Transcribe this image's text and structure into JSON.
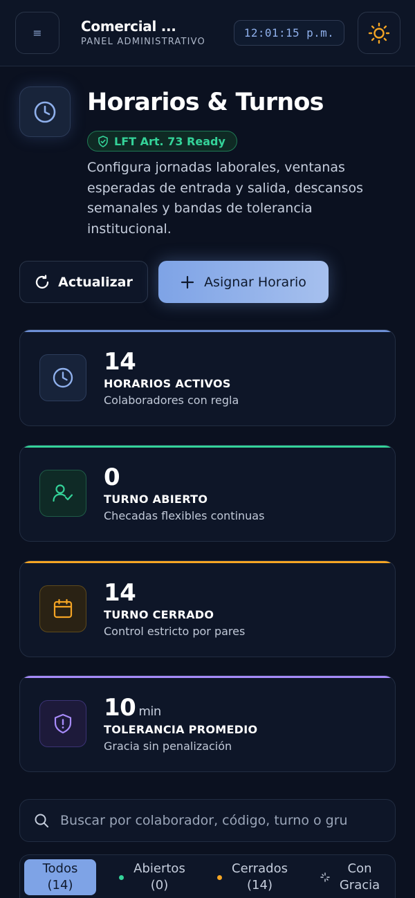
{
  "header": {
    "menu_icon": "≡",
    "brand_title": "Comercial ...",
    "brand_subtitle": "PANEL ADMINISTRATIVO",
    "clock": "12:01:15 p.m.",
    "theme_icon": "sun-icon"
  },
  "page": {
    "title": "Horarios & Turnos",
    "badge": "LFT Art. 73 Ready",
    "description": "Configura jornadas laborales, ventanas esperadas de entrada y salida, descansos semanales y bandas de tolerancia institucional."
  },
  "actions": {
    "refresh_label": "Actualizar",
    "assign_label": "Asignar Horario"
  },
  "stats": [
    {
      "value": "14",
      "unit": "",
      "label": "HORARIOS ACTIVOS",
      "sub": "Colaboradores con regla",
      "color": "#6d8fd6"
    },
    {
      "value": "0",
      "unit": "",
      "label": "TURNO ABIERTO",
      "sub": "Checadas flexibles continuas",
      "color": "#34d399"
    },
    {
      "value": "14",
      "unit": "",
      "label": "TURNO CERRADO",
      "sub": "Control estricto por pares",
      "color": "#f5a524"
    },
    {
      "value": "10",
      "unit": "min",
      "label": "TOLERANCIA PROMEDIO",
      "sub": "Gracia sin penalización",
      "color": "#a78bfa"
    }
  ],
  "search": {
    "placeholder": "Buscar por colaborador, código, turno o gru"
  },
  "filters": [
    {
      "line1": "Todos",
      "line2": "(14)"
    },
    {
      "line1": "Abiertos",
      "line2": "(0)"
    },
    {
      "line1": "Cerrados",
      "line2": "(14)"
    },
    {
      "line1": "Con",
      "line2": "Gracia"
    }
  ]
}
